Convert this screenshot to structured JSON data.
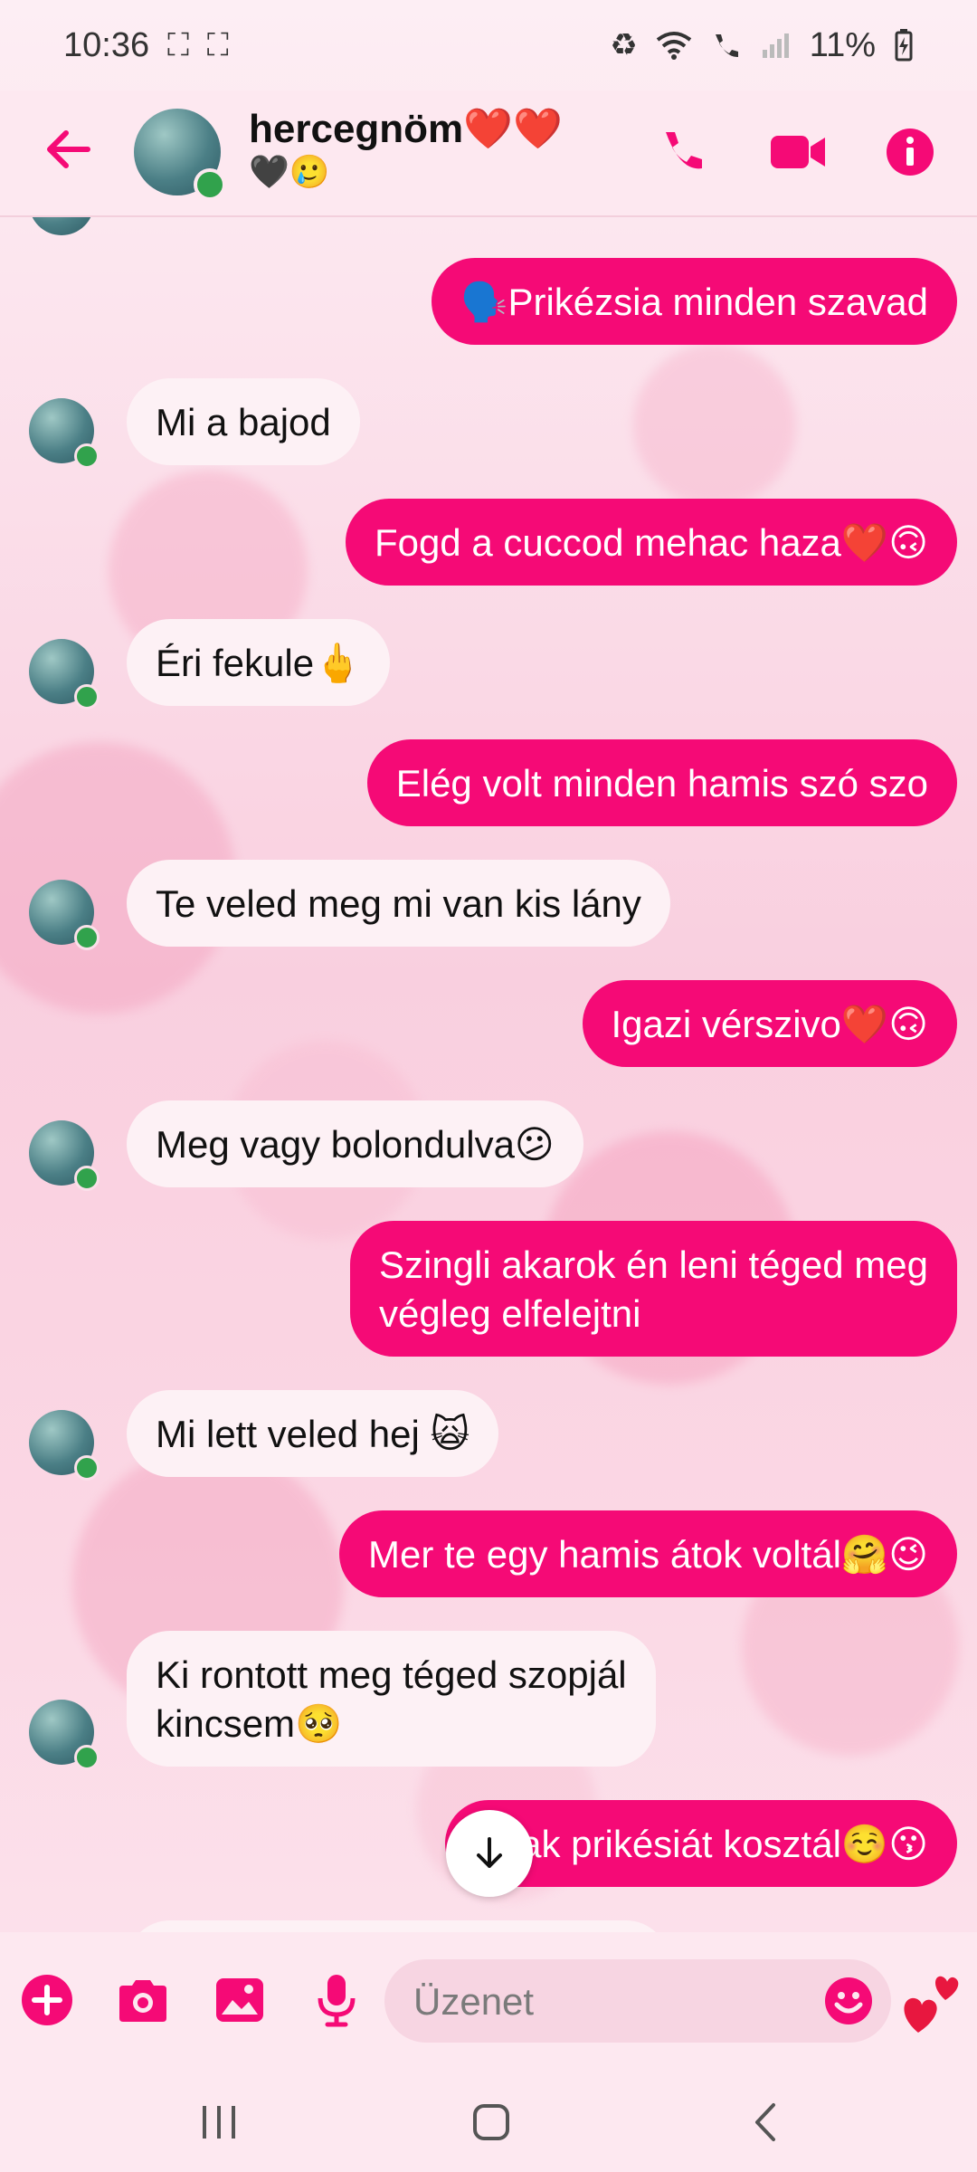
{
  "status": {
    "time": "10:36",
    "battery": "11%"
  },
  "header": {
    "name": "hercegnöm❤️❤️",
    "subtitle": "🖤🥲"
  },
  "messages": [
    {
      "dir": "out",
      "text": "🗣️Prikézsia minden szavad"
    },
    {
      "dir": "in",
      "text": "Mi a bajod"
    },
    {
      "dir": "out",
      "text": "Fogd a cuccod mehac haza❤️🙃"
    },
    {
      "dir": "in",
      "text": "Éri fekule🖕"
    },
    {
      "dir": "out",
      "text": "Elég volt minden hamis szó szo"
    },
    {
      "dir": "in",
      "text": "Te veled meg mi van kis lány"
    },
    {
      "dir": "out",
      "text": "Igazi vérszivo❤️🙃"
    },
    {
      "dir": "in",
      "text": "Meg vagy bolondulva😕"
    },
    {
      "dir": "out",
      "text": "Szingli akarok én leni téged meg\nvégleg elfelejtni"
    },
    {
      "dir": "in",
      "text": "Mi lett veled hej 🙀"
    },
    {
      "dir": "out",
      "text": "Mer te egy hamis átok voltál🤗😉"
    },
    {
      "dir": "in",
      "text": "Ki rontott meg téged szopjál\nkincsem🥺"
    },
    {
      "dir": "out",
      "text": "Csak prikésiát kosztál☺️😗"
    }
  ],
  "composer": {
    "placeholder": "Üzenet"
  },
  "colors": {
    "accent": "#f50a76",
    "incoming_bubble": "#fdf1f5",
    "background": "#fbd7e4"
  },
  "icons": {
    "header": [
      "back-arrow-icon",
      "phone-icon",
      "video-icon",
      "info-icon"
    ],
    "composer": [
      "plus-icon",
      "camera-icon",
      "image-icon",
      "mic-icon",
      "emoji-icon",
      "hearts-icon"
    ],
    "nav": [
      "recent-apps-icon",
      "home-icon",
      "back-icon"
    ]
  }
}
